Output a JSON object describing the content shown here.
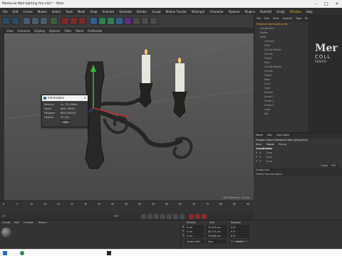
{
  "window": {
    "title": "Medieval Wall-lighting fire.c4d * - Main"
  },
  "menu": [
    "File",
    "Edit",
    "Create",
    "Modes",
    "Select",
    "Tools",
    "Mesh",
    "Snap",
    "Animate",
    "Simulate",
    "Render",
    "Sculpt",
    "Motion Tracker",
    "MoGraph",
    "Character",
    "Pipeline",
    "Plugins",
    "Redshift",
    "Script",
    "Window",
    "Help"
  ],
  "menu_active": "Window",
  "view": {
    "menu": [
      "View",
      "Cameras",
      "Display",
      "Options",
      "Filter",
      "Panel",
      "ProRender"
    ],
    "grid_spacing": "Grid Spacing : 10 cm"
  },
  "object_manager": {
    "tabs": [
      "File",
      "Edit",
      "View",
      "Objects",
      "Tags",
      "Bookmarks"
    ],
    "items": [
      "Medieval Wall-lighting fire",
      "Candle Arm",
      "Holder",
      "Base",
      "Cylinder",
      "Stick",
      "Candle Holder",
      "Candle",
      "Flame",
      "Wick",
      "Candle Holder",
      "Candle",
      "Flame",
      "Wick",
      "Cone",
      "Tube",
      "Screws",
      "Screw 1",
      "Screw 2",
      "Screw 3",
      "Light",
      "Sky"
    ]
  },
  "logo": {
    "text1": "Mer",
    "text2": "COLL",
    "text3": "RENATO"
  },
  "attributes": {
    "tabs": [
      "Mode",
      "Edit",
      "User Data"
    ],
    "object": "Polygon Object [Medieval Wall-lighting fire]",
    "subtabs": [
      "Basic",
      "Coord.",
      "Phong"
    ],
    "section": "Coordinates",
    "rows": [
      {
        "label": "P . X",
        "value": "0 cm"
      },
      {
        "label": "P . Y",
        "value": "0 cm"
      },
      {
        "label": "P . Z",
        "value": "0 cm"
      }
    ],
    "order_label": "Order",
    "order_value": "HPB",
    "sections": [
      "Quaternion",
      "Freeze Transformation"
    ]
  },
  "info_dialog": {
    "title": "Information",
    "rows": [
      {
        "label": "Memory",
        "value": "ca. 731 KByte"
      },
      {
        "label": "Points",
        "value": "6081 (6081)"
      },
      {
        "label": "Polygons",
        "value": "6000 (6000)"
      },
      {
        "label": "Objects",
        "value": "32 (41)"
      }
    ],
    "ok": "OK"
  },
  "timeline": {
    "ticks": [
      "0",
      "5",
      "10",
      "15",
      "20",
      "25",
      "30",
      "35",
      "40",
      "45",
      "50",
      "55",
      "60",
      "65",
      "70",
      "75",
      "80",
      "85",
      "90"
    ],
    "frame_start": "0 F",
    "frame_end": "90 F"
  },
  "material_manager": {
    "menu": [
      "Create",
      "Edit",
      "Function",
      "Texture"
    ]
  },
  "coordinates": {
    "headers": [
      "Position",
      "Size",
      "Rotation"
    ],
    "rows": [
      {
        "axis": "X",
        "pos": "0 cm",
        "size": "72.931 cm",
        "rot": "H 0°"
      },
      {
        "axis": "Y",
        "pos": "0 cm",
        "size": "62.774 cm",
        "rot": "P 0°"
      },
      {
        "axis": "Z",
        "pos": "0 cm",
        "size": "35.888 cm",
        "rot": "B 0°"
      }
    ],
    "mode": "Object (Rel)",
    "size_mode": "Size",
    "apply": "Apply"
  }
}
